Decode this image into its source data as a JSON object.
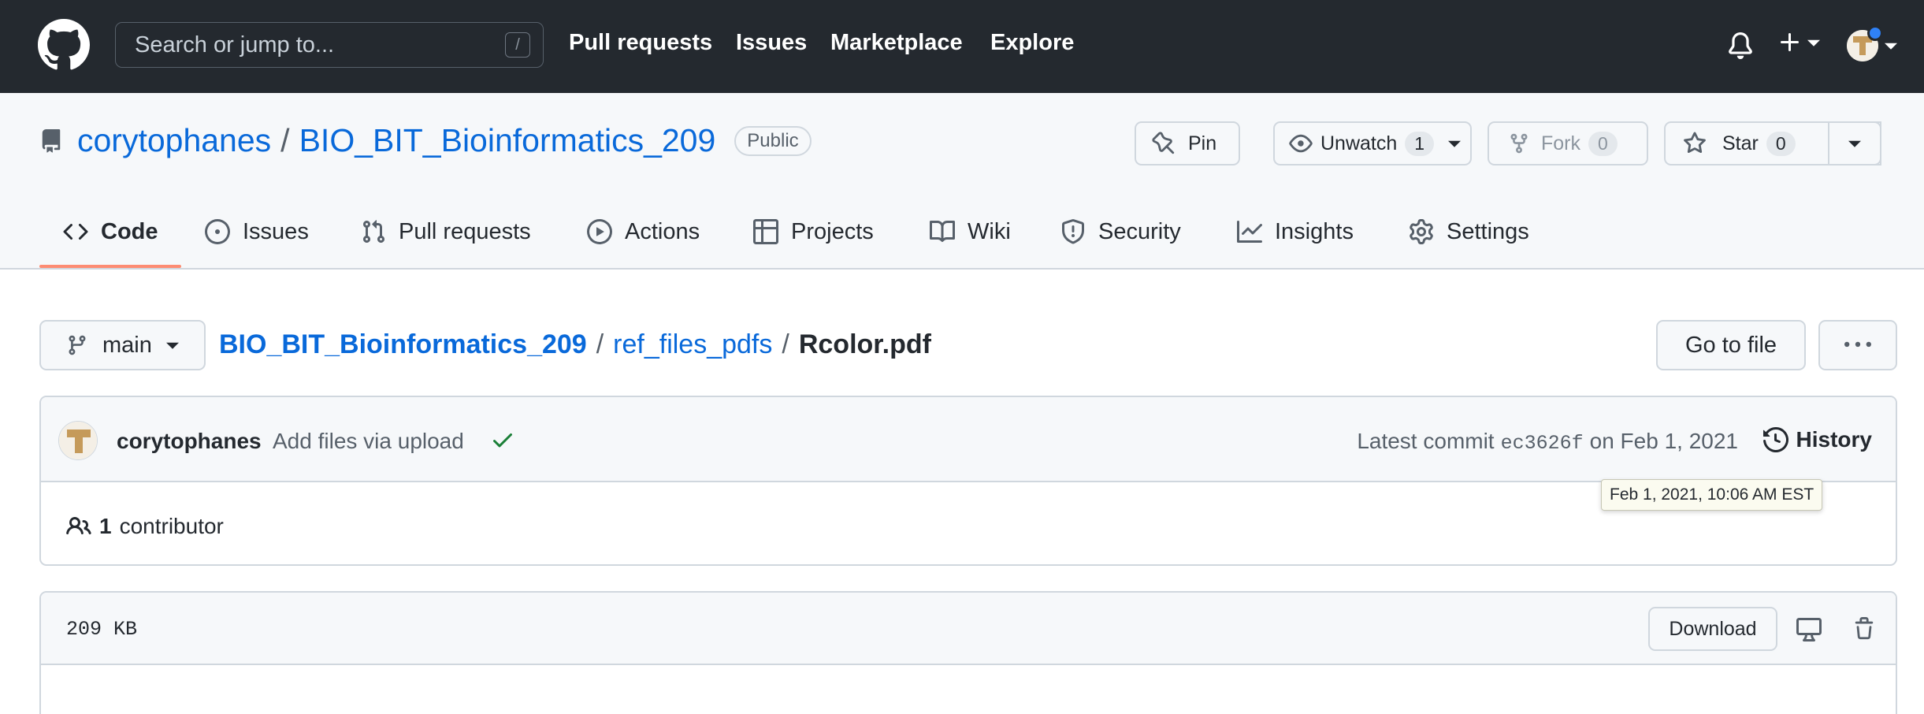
{
  "header": {
    "search_placeholder": "Search or jump to...",
    "search_shortcut": "/",
    "nav": [
      "Pull requests",
      "Issues",
      "Marketplace",
      "Explore"
    ]
  },
  "repo": {
    "owner": "corytophanes",
    "separator": "/",
    "name": "BIO_BIT_Bioinformatics_209",
    "visibility": "Public",
    "pin_label": "Pin",
    "watch_label": "Unwatch",
    "watch_count": "1",
    "fork_label": "Fork",
    "fork_count": "0",
    "star_label": "Star",
    "star_count": "0"
  },
  "tabs": [
    {
      "label": "Code",
      "icon": "code-icon",
      "active": true
    },
    {
      "label": "Issues",
      "icon": "issue-opened-icon"
    },
    {
      "label": "Pull requests",
      "icon": "git-pull-request-icon"
    },
    {
      "label": "Actions",
      "icon": "play-icon"
    },
    {
      "label": "Projects",
      "icon": "table-icon"
    },
    {
      "label": "Wiki",
      "icon": "book-icon"
    },
    {
      "label": "Security",
      "icon": "shield-icon"
    },
    {
      "label": "Insights",
      "icon": "graph-icon"
    },
    {
      "label": "Settings",
      "icon": "gear-icon"
    }
  ],
  "file_nav": {
    "branch": "main",
    "path": [
      "BIO_BIT_Bioinformatics_209",
      "ref_files_pdfs"
    ],
    "path_separator": "/",
    "file_name": "Rcolor.pdf",
    "go_to_file": "Go to file"
  },
  "commit": {
    "author": "corytophanes",
    "message": "Add files via upload",
    "latest_prefix": "Latest commit",
    "sha": "ec3626f",
    "date": "on Feb 1, 2021",
    "history_label": "History",
    "tooltip": "Feb 1, 2021, 10:06 AM EST",
    "contributor_count": "1",
    "contributor_label": "contributor"
  },
  "file": {
    "size": "209 KB",
    "download_label": "Download"
  },
  "colors": {
    "header_bg": "#24292f",
    "link": "#0969da",
    "tab_underline": "#fd8c73",
    "success": "#1a7f37",
    "notification_dot": "#2f81f7"
  }
}
